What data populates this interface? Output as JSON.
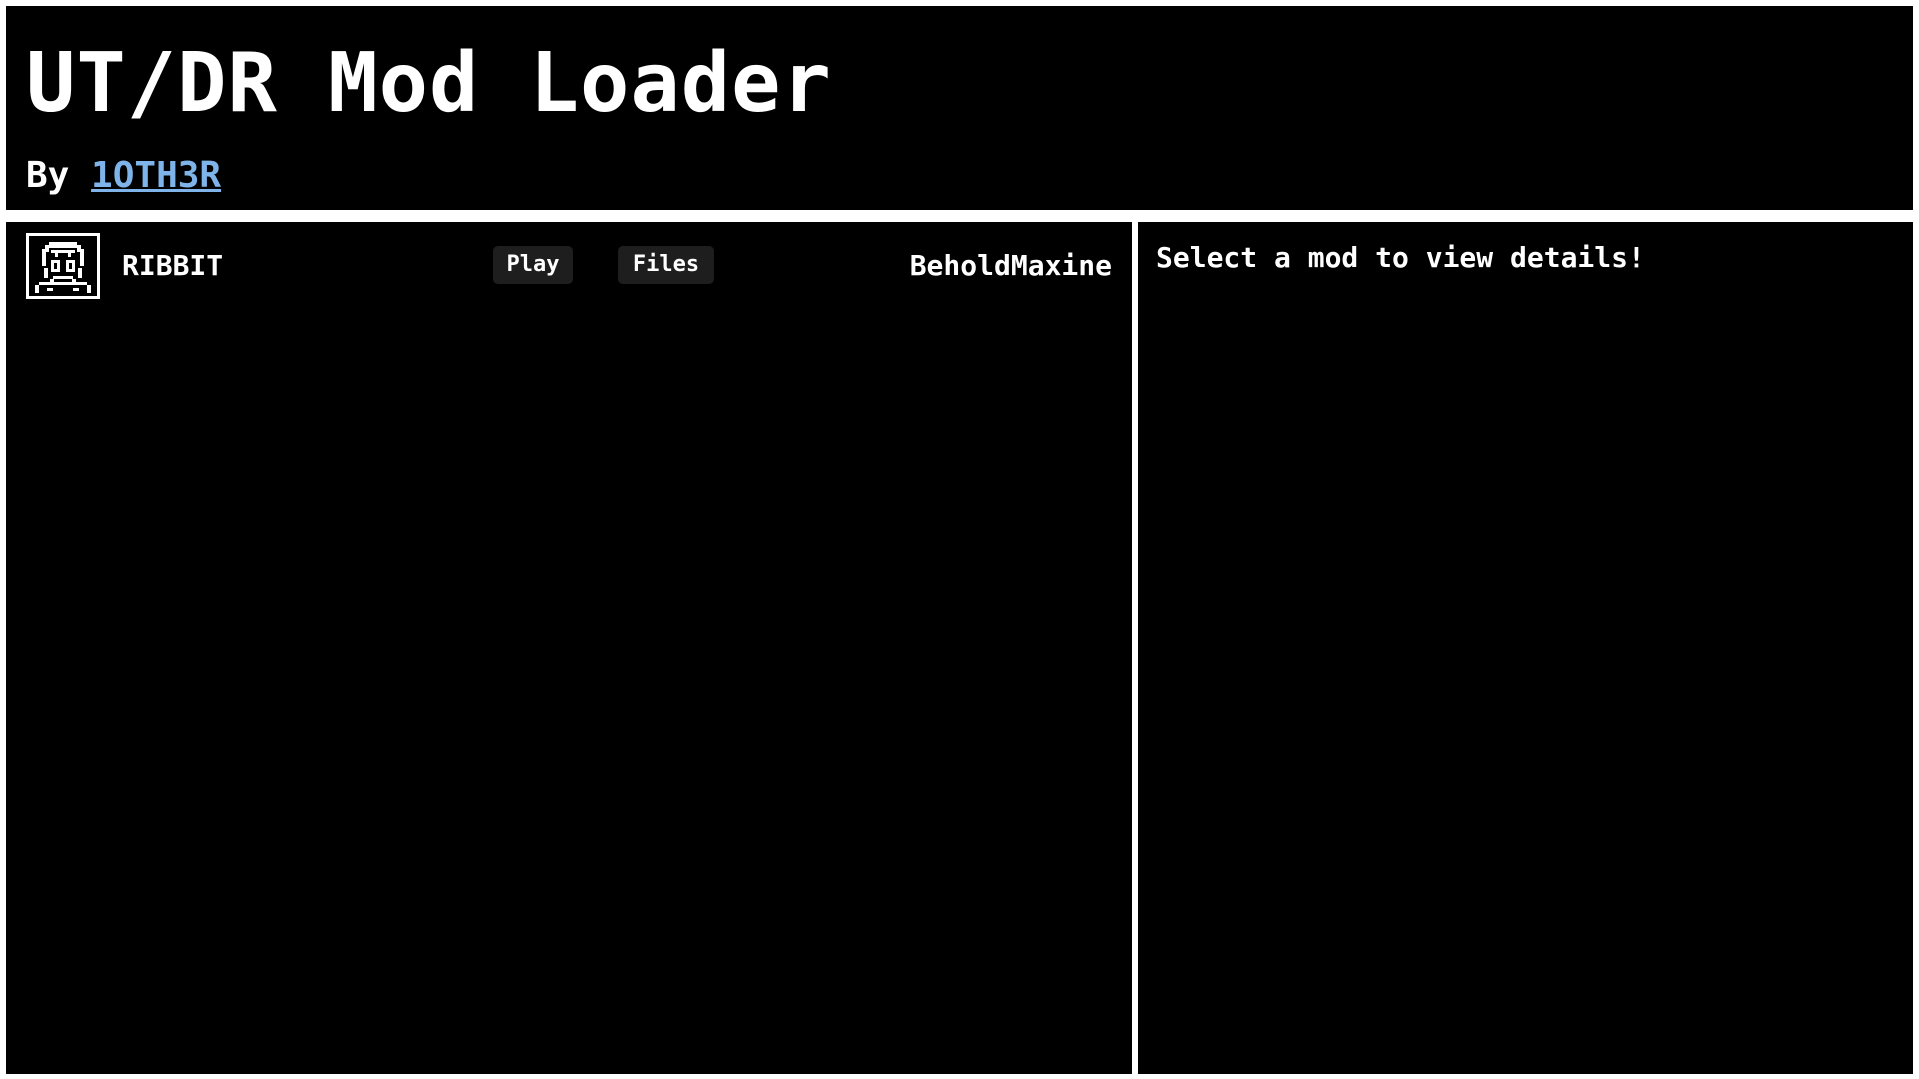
{
  "header": {
    "title": "UT/DR Mod Loader",
    "byline_prefix": "By",
    "author_link": "1OTH3R"
  },
  "mods": [
    {
      "name": "RIBBIT",
      "icon": "frog-character-icon",
      "play_label": "Play",
      "files_label": "Files",
      "author": "BeholdMaxine"
    }
  ],
  "details": {
    "placeholder": "Select a mod to view details!"
  },
  "colors": {
    "background": "#000000",
    "frame": "#ffffff",
    "text": "#ffffff",
    "link": "#7eb4ea",
    "button": "#1e1e1e"
  }
}
